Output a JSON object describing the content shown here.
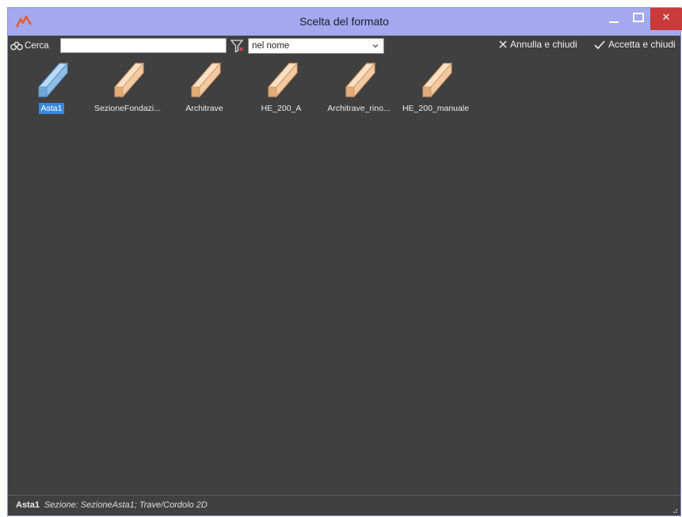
{
  "window": {
    "title": "Scelta del formato",
    "close_glyph": "✕"
  },
  "toolbar": {
    "search_label": "Cerca",
    "search_value": "",
    "search_placeholder": "",
    "search_mode": "nel nome",
    "cancel_label": "Annulla e chiudi",
    "accept_label": "Accetta e chiudi"
  },
  "items": [
    {
      "label": "Asta1",
      "selected": true,
      "icon": "beam-icon-blue"
    },
    {
      "label": "SezioneFondazi...",
      "selected": false,
      "icon": "beam-icon-orange"
    },
    {
      "label": "Architrave",
      "selected": false,
      "icon": "beam-icon-orange"
    },
    {
      "label": "HE_200_A",
      "selected": false,
      "icon": "beam-icon-orange"
    },
    {
      "label": "Architrave_rino...",
      "selected": false,
      "icon": "beam-icon-orange"
    },
    {
      "label": "HE_200_manuale",
      "selected": false,
      "icon": "beam-icon-orange"
    }
  ],
  "status": {
    "name": "Asta1",
    "description": "Sezione: SezioneAsta1; Trave/Cordolo 2D"
  },
  "colors": {
    "titlebar": "#a3a8ef",
    "background": "#404040",
    "selection": "#3a87e0",
    "beam_orange": "#f2c9a0",
    "beam_blue": "#8fbde6",
    "close_button": "#c93a3a"
  }
}
